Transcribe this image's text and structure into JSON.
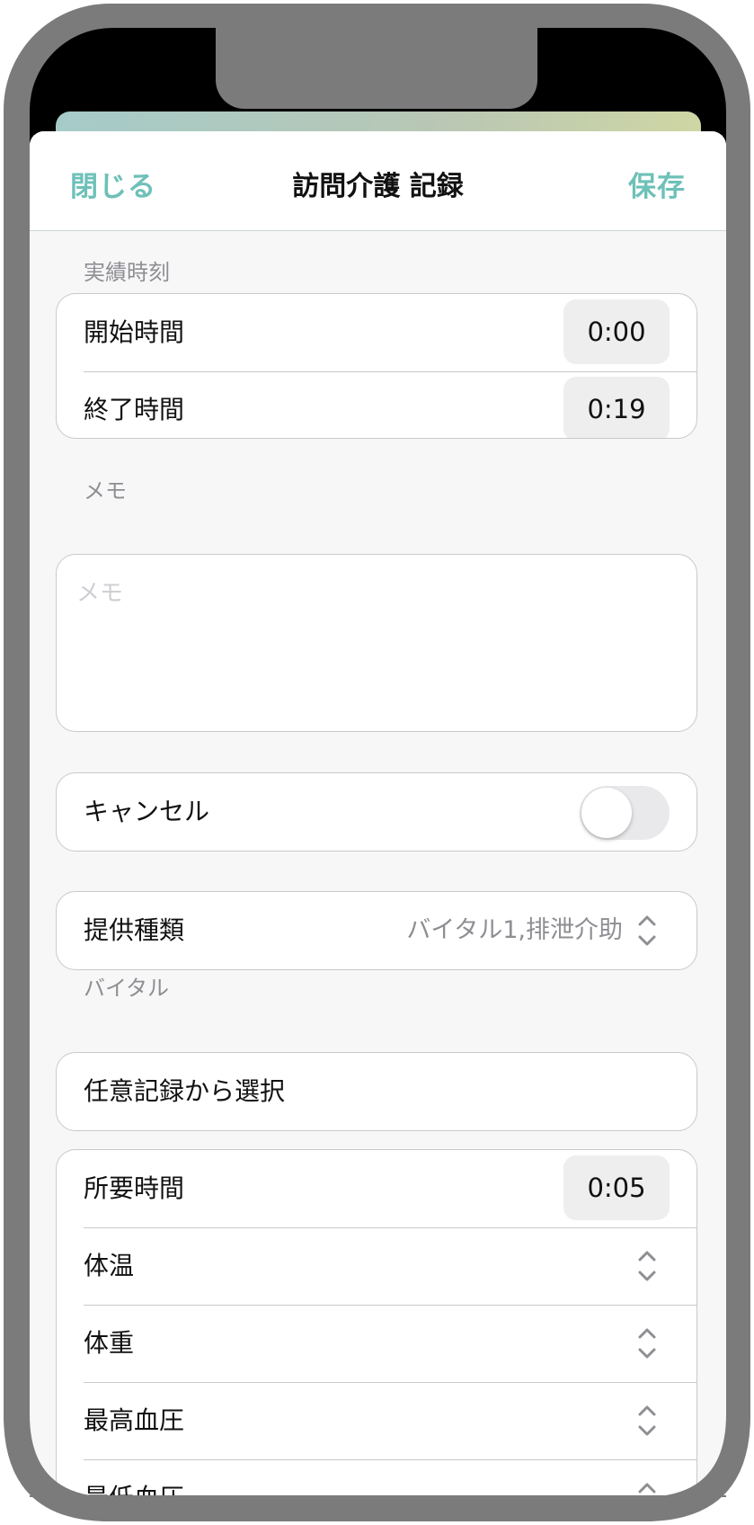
{
  "colors": {
    "accent": "#6ec0b8",
    "frame": "#7b7b7b",
    "secondary_text": "#8e8e93"
  },
  "nav": {
    "close_label": "閉じる",
    "title": "訪問介護 記録",
    "save_label": "保存"
  },
  "actual_time": {
    "section_label": "実績時刻",
    "start_label": "開始時間",
    "start_value": "0:00",
    "end_label": "終了時間",
    "end_value": "0:19"
  },
  "memo": {
    "section_label": "メモ",
    "placeholder": "メモ"
  },
  "cancel": {
    "label": "キャンセル",
    "toggle_on": false
  },
  "service_type": {
    "label": "提供種類",
    "value": "バイタル1,排泄介助"
  },
  "vital": {
    "section_label": "バイタル",
    "select_label": "任意記録から選択",
    "duration_label": "所要時間",
    "duration_value": "0:05",
    "rows": [
      {
        "label": "体温"
      },
      {
        "label": "体重"
      },
      {
        "label": "最高血圧"
      },
      {
        "label": "最低血圧"
      }
    ]
  }
}
